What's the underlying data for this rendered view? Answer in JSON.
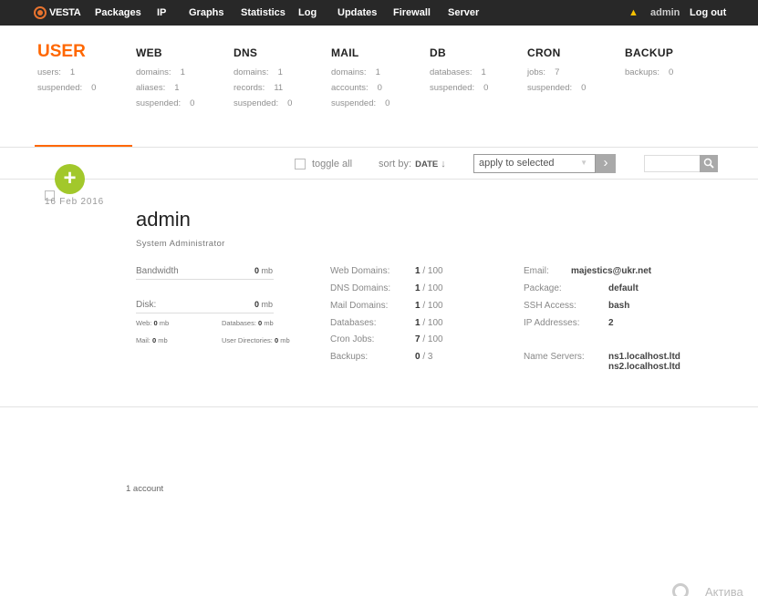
{
  "topbar": {
    "logo": "VESTA",
    "nav": [
      "Packages",
      "IP",
      "Graphs",
      "Statistics",
      "Log",
      "Updates",
      "Firewall",
      "Server"
    ],
    "user": "admin",
    "logout": "Log out"
  },
  "stats": {
    "user": {
      "title": "USER",
      "rows": [
        {
          "k": "users:",
          "v": "1"
        },
        {
          "k": "suspended:",
          "v": "0"
        }
      ]
    },
    "web": {
      "title": "WEB",
      "rows": [
        {
          "k": "domains:",
          "v": "1"
        },
        {
          "k": "aliases:",
          "v": "1"
        },
        {
          "k": "suspended:",
          "v": "0"
        }
      ]
    },
    "dns": {
      "title": "DNS",
      "rows": [
        {
          "k": "domains:",
          "v": "1"
        },
        {
          "k": "records:",
          "v": "11"
        },
        {
          "k": "suspended:",
          "v": "0"
        }
      ]
    },
    "mail": {
      "title": "MAIL",
      "rows": [
        {
          "k": "domains:",
          "v": "1"
        },
        {
          "k": "accounts:",
          "v": "0"
        },
        {
          "k": "suspended:",
          "v": "0"
        }
      ]
    },
    "db": {
      "title": "DB",
      "rows": [
        {
          "k": "databases:",
          "v": "1"
        },
        {
          "k": "suspended:",
          "v": "0"
        }
      ]
    },
    "cron": {
      "title": "CRON",
      "rows": [
        {
          "k": "jobs:",
          "v": "7"
        },
        {
          "k": "suspended:",
          "v": "0"
        }
      ]
    },
    "backup": {
      "title": "BACKUP",
      "rows": [
        {
          "k": "backups:",
          "v": "0"
        }
      ]
    }
  },
  "toolbar": {
    "toggle_all": "toggle all",
    "sort_by": "sort by:",
    "sort_value": "DATE",
    "sort_arrow": "↓",
    "bulk_action": "apply to selected"
  },
  "account": {
    "date": "16 Feb 2016",
    "username": "admin",
    "fullname": "System Administrator",
    "bandwidth_label": "Bandwidth",
    "bandwidth_value": "0",
    "disk_label": "Disk:",
    "disk_value": "0",
    "unit": "mb",
    "web_label": "Web:",
    "web_value": "0",
    "databases_label": "Databases:",
    "databases_value": "0",
    "mail_label": "Mail:",
    "mail_value": "0",
    "userdirs_label": "User Directories:",
    "userdirs_value": "0",
    "limits": [
      {
        "label": "Web Domains:",
        "used": "1",
        "max": "100"
      },
      {
        "label": "DNS Domains:",
        "used": "1",
        "max": "100"
      },
      {
        "label": "Mail Domains:",
        "used": "1",
        "max": "100"
      },
      {
        "label": "Databases:",
        "used": "1",
        "max": "100"
      },
      {
        "label": "Cron Jobs:",
        "used": "7",
        "max": "100"
      },
      {
        "label": "Backups:",
        "used": "0",
        "max": "3"
      }
    ],
    "email_label": "Email:",
    "email": "majestics@ukr.net",
    "package_label": "Package:",
    "package": "default",
    "ssh_label": "SSH Access:",
    "ssh": "bash",
    "ip_label": "IP Addresses:",
    "ip": "2",
    "ns_label": "Name Servers:",
    "ns1": "ns1.localhost.ltd",
    "ns2": "ns2.localhost.ltd"
  },
  "footer": {
    "count": "1 account"
  },
  "watermark": "Актива",
  "colors": {
    "accent": "#ff6701",
    "add": "#a2c82b",
    "topbar": "#282828"
  }
}
